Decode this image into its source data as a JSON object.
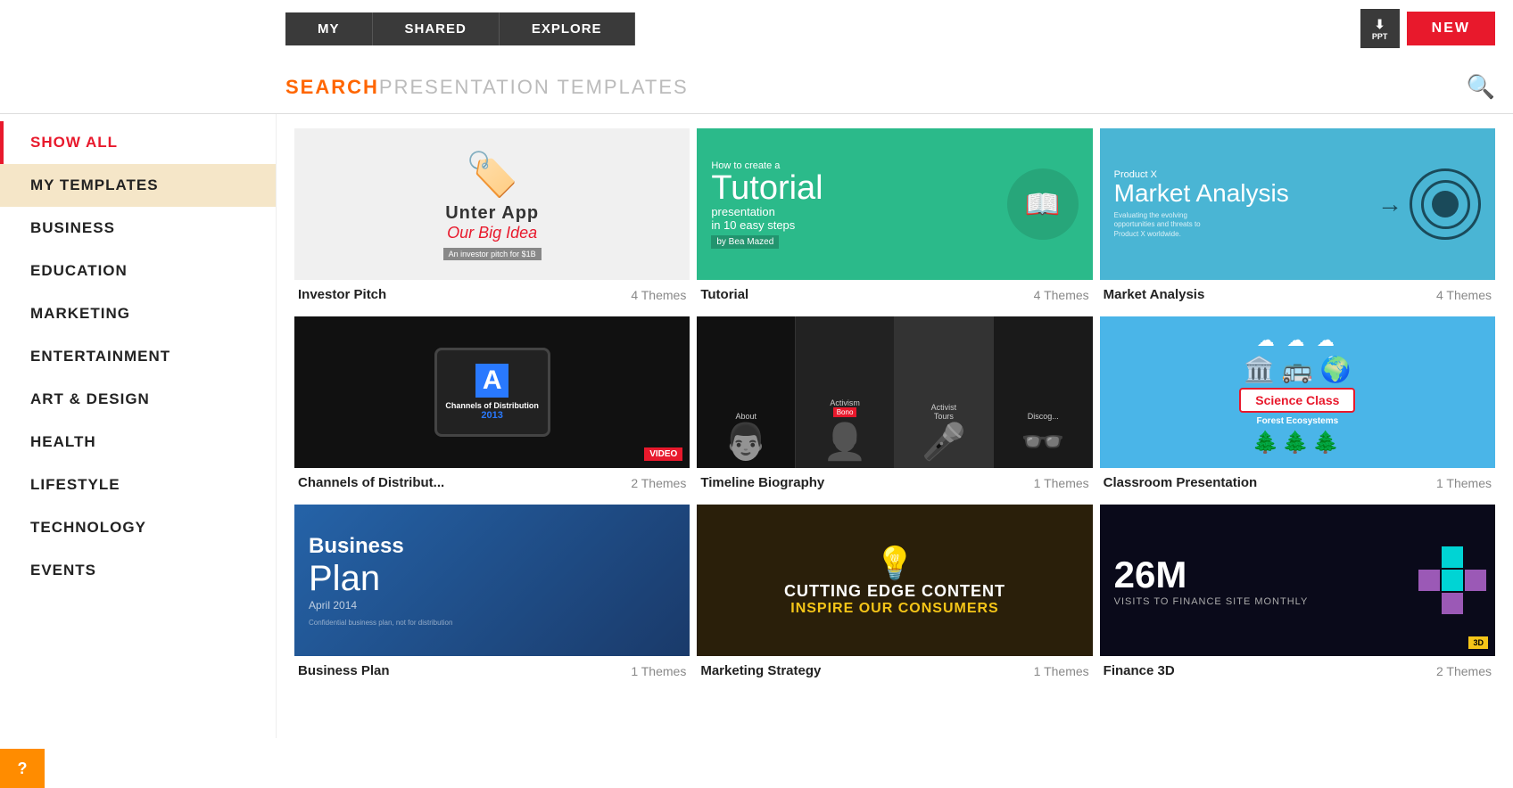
{
  "nav": {
    "tabs": [
      "MY",
      "SHARED",
      "EXPLORE"
    ],
    "ppt_label": "PPT",
    "new_label": "NEW"
  },
  "search": {
    "placeholder_highlight": "SEARCH",
    "placeholder_rest": " PRESENTATION TEMPLATES"
  },
  "sidebar": {
    "items": [
      {
        "id": "show-all",
        "label": "SHOW ALL",
        "active": true
      },
      {
        "id": "my-templates",
        "label": "MY TEMPLATES",
        "selected": true
      },
      {
        "id": "business",
        "label": "BUSINESS"
      },
      {
        "id": "education",
        "label": "EDUCATION"
      },
      {
        "id": "marketing",
        "label": "MARKETING"
      },
      {
        "id": "entertainment",
        "label": "ENTERTAINMENT"
      },
      {
        "id": "art-design",
        "label": "ART & DESIGN"
      },
      {
        "id": "health",
        "label": "HEALTH"
      },
      {
        "id": "lifestyle",
        "label": "LIFESTYLE"
      },
      {
        "id": "technology",
        "label": "TECHNOLOGY"
      },
      {
        "id": "events",
        "label": "EVENTS"
      }
    ],
    "help_label": "?"
  },
  "cards": [
    {
      "id": "investor-pitch",
      "title": "Investor Pitch",
      "themes": "4 Themes",
      "thumb_type": "investor"
    },
    {
      "id": "tutorial",
      "title": "Tutorial",
      "themes": "4 Themes",
      "thumb_type": "tutorial"
    },
    {
      "id": "market-analysis",
      "title": "Market Analysis",
      "themes": "4 Themes",
      "thumb_type": "market"
    },
    {
      "id": "channels-distribution",
      "title": "Channels of Distribut...",
      "themes": "2 Themes",
      "thumb_type": "distrib"
    },
    {
      "id": "timeline-biography",
      "title": "Timeline Biography",
      "themes": "1 Themes",
      "thumb_type": "bio"
    },
    {
      "id": "classroom-presentation",
      "title": "Classroom Presentation",
      "themes": "1 Themes",
      "thumb_type": "classroom"
    },
    {
      "id": "business-plan",
      "title": "Business Plan",
      "themes": "1 Themes",
      "thumb_type": "bizplan"
    },
    {
      "id": "marketing-strategy",
      "title": "Marketing Strategy",
      "themes": "1 Themes",
      "thumb_type": "marketing"
    },
    {
      "id": "finance-3d",
      "title": "Finance 3D",
      "themes": "2 Themes",
      "thumb_type": "finance"
    }
  ],
  "thumbs": {
    "investor": {
      "app_name": "Unter App",
      "tagline": "Our Big Idea",
      "sub": "An investor pitch for $1B"
    },
    "tutorial": {
      "how_to": "How to create a",
      "big": "Tutorial",
      "rest": "presentation\nin 10 easy steps",
      "by": "by Bea Mazed"
    },
    "market": {
      "product": "Product X",
      "big": "Market Analysis",
      "desc": "Evaluating the evolving opportunities and threats to Product X worldwide."
    },
    "distrib": {
      "letter": "A",
      "title": "Channels of Distribution",
      "year": "2013",
      "badge": "VIDEO"
    },
    "bio": {
      "cols": [
        "About",
        "Activism",
        "Activist\nTours",
        "Discog..."
      ]
    },
    "classroom": {
      "title": "Science Class",
      "sub": "Forest Ecosystems"
    },
    "bizplan": {
      "title": "Business",
      "plan": "Plan",
      "date": "April 2014",
      "conf": "Confidential business plan, not for distribution"
    },
    "marketing": {
      "line1": "CUTTING EDGE CONTENT",
      "line2": "INSPIRE OUR CONSUMERS"
    },
    "finance": {
      "number": "26M",
      "visits": "VISITS TO FINANCE SITE MONTHLY",
      "badge": "3D"
    }
  }
}
